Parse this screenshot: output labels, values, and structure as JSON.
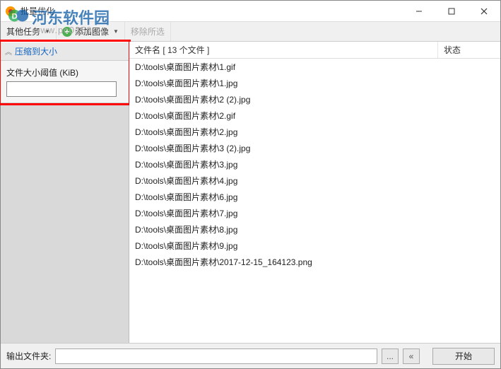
{
  "window": {
    "title": "批量优化"
  },
  "watermark": {
    "brand": "河东软件园",
    "url": "www.pc0359.cn"
  },
  "toolbar": {
    "other_tasks": "其他任务",
    "add_image": "添加图像",
    "remove_selected": "移除所选"
  },
  "sidebar": {
    "panel_title": "压缩到大小",
    "threshold_label": "文件大小阈值 (KiB)",
    "threshold_value": ""
  },
  "filelist": {
    "header_name": "文件名 [ 13 个文件 ]",
    "header_status": "状态",
    "rows": [
      "D:\\tools\\桌面图片素材\\1.gif",
      "D:\\tools\\桌面图片素材\\1.jpg",
      "D:\\tools\\桌面图片素材\\2 (2).jpg",
      "D:\\tools\\桌面图片素材\\2.gif",
      "D:\\tools\\桌面图片素材\\2.jpg",
      "D:\\tools\\桌面图片素材\\3 (2).jpg",
      "D:\\tools\\桌面图片素材\\3.jpg",
      "D:\\tools\\桌面图片素材\\4.jpg",
      "D:\\tools\\桌面图片素材\\6.jpg",
      "D:\\tools\\桌面图片素材\\7.jpg",
      "D:\\tools\\桌面图片素材\\8.jpg",
      "D:\\tools\\桌面图片素材\\9.jpg",
      "D:\\tools\\桌面图片素材\\2017-12-15_164123.png"
    ]
  },
  "footer": {
    "output_label": "输出文件夹:",
    "output_value": "",
    "browse": "...",
    "back": "«",
    "start": "开始"
  }
}
